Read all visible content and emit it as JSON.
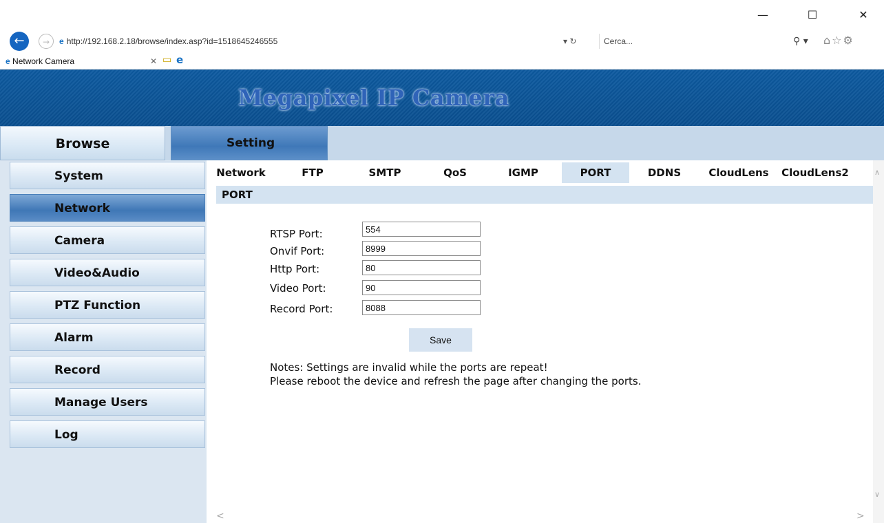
{
  "browser": {
    "url": "http://192.168.2.18/browse/index.asp?id=1518645246555",
    "search_placeholder": "Cerca...",
    "tab_title": "Network Camera",
    "window_controls": {
      "minimize": "—",
      "maximize": "☐",
      "close": "✕"
    }
  },
  "banner": {
    "title": "Megapixel IP Camera"
  },
  "topnav": {
    "browse": "Browse",
    "setting": "Setting"
  },
  "sidebar": {
    "items": [
      {
        "label": "System"
      },
      {
        "label": "Network"
      },
      {
        "label": "Camera"
      },
      {
        "label": "Video&Audio"
      },
      {
        "label": "PTZ Function"
      },
      {
        "label": "Alarm"
      },
      {
        "label": "Record"
      },
      {
        "label": "Manage Users"
      },
      {
        "label": "Log"
      }
    ],
    "active": "Network"
  },
  "subtabs": {
    "items": [
      "Network",
      "FTP",
      "SMTP",
      "QoS",
      "IGMP",
      "PORT",
      "DDNS",
      "CloudLens",
      "CloudLens2"
    ],
    "active": "PORT"
  },
  "section": {
    "title": "PORT"
  },
  "form": {
    "rtsp_label": "RTSP Port:",
    "rtsp_value": "554",
    "onvif_label": "Onvif Port:",
    "onvif_value": "8999",
    "http_label": "Http Port:",
    "http_value": "80",
    "video_label": "Video Port:",
    "video_value": "90",
    "record_label": "Record Port:",
    "record_value": "8088",
    "save_label": "Save"
  },
  "notes": {
    "line1": "Notes: Settings are invalid while the ports are repeat!",
    "line2": "Please reboot the device and refresh the page after changing the ports."
  },
  "colors": {
    "banner": "#0a4f90",
    "title": "#2f63b8",
    "active_tab": "#3f77b6",
    "panel": "#d4e3f1"
  }
}
